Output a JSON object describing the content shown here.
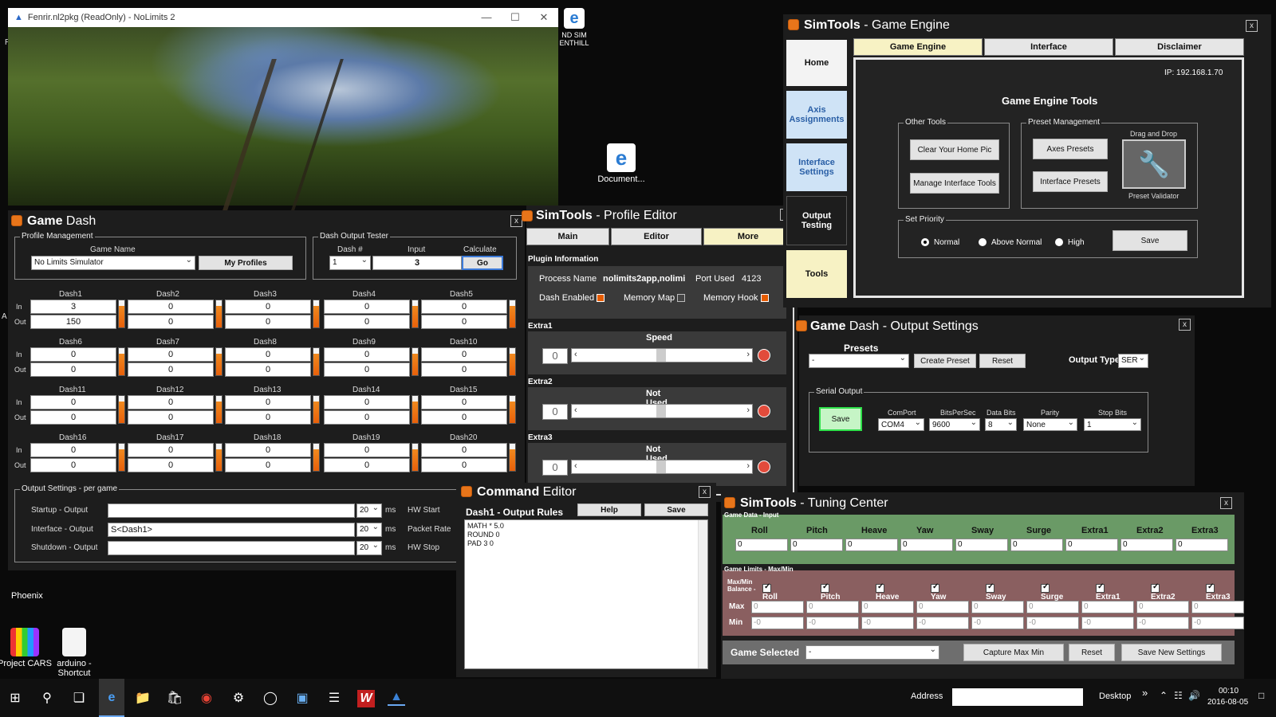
{
  "desktop": {
    "icons": [
      {
        "label": "Document...",
        "color": "#2b7cd3"
      },
      {
        "label": "Phoenix",
        "color": "#333"
      },
      {
        "label": "Project CARS",
        "color": "#1a7ad4"
      },
      {
        "label": "arduino - Shortcut",
        "color": "#f2f2f2"
      }
    ],
    "edge_shortcut_lines": [
      "ND SIM",
      "ENTHILL"
    ],
    "left_fragments": [
      "R",
      "A"
    ]
  },
  "nolimits": {
    "title": "Fenrir.nl2pkg (ReadOnly) - NoLimits 2",
    "controls": [
      "—",
      "☐",
      "✕"
    ]
  },
  "game_dash": {
    "title_bold": "Game",
    "title_rest": " Dash",
    "profile_mgmt": {
      "label": "Profile Management",
      "game_name_label": "Game Name",
      "game_name_value": "No Limits Simulator",
      "my_profiles": "My Profiles"
    },
    "tester": {
      "label": "Dash Output Tester",
      "dash_num_label": "Dash #",
      "dash_num_value": "1",
      "input_label": "Input",
      "input_value": "3",
      "calculate_label": "Calculate",
      "go": "Go"
    },
    "in_label": "In",
    "out_label": "Out",
    "dashes": [
      {
        "name": "Dash1",
        "in": "3",
        "out": "150"
      },
      {
        "name": "Dash2",
        "in": "0",
        "out": "0"
      },
      {
        "name": "Dash3",
        "in": "0",
        "out": "0"
      },
      {
        "name": "Dash4",
        "in": "0",
        "out": "0"
      },
      {
        "name": "Dash5",
        "in": "0",
        "out": "0"
      },
      {
        "name": "Dash6",
        "in": "0",
        "out": "0"
      },
      {
        "name": "Dash7",
        "in": "0",
        "out": "0"
      },
      {
        "name": "Dash8",
        "in": "0",
        "out": "0"
      },
      {
        "name": "Dash9",
        "in": "0",
        "out": "0"
      },
      {
        "name": "Dash10",
        "in": "0",
        "out": "0"
      },
      {
        "name": "Dash11",
        "in": "0",
        "out": "0"
      },
      {
        "name": "Dash12",
        "in": "0",
        "out": "0"
      },
      {
        "name": "Dash13",
        "in": "0",
        "out": "0"
      },
      {
        "name": "Dash14",
        "in": "0",
        "out": "0"
      },
      {
        "name": "Dash15",
        "in": "0",
        "out": "0"
      },
      {
        "name": "Dash16",
        "in": "0",
        "out": "0"
      },
      {
        "name": "Dash17",
        "in": "0",
        "out": "0"
      },
      {
        "name": "Dash18",
        "in": "0",
        "out": "0"
      },
      {
        "name": "Dash19",
        "in": "0",
        "out": "0"
      },
      {
        "name": "Dash20",
        "in": "0",
        "out": "0"
      }
    ],
    "output_settings": {
      "label": "Output Settings - per game",
      "ms": "ms",
      "rows": [
        {
          "label": "Startup - Output",
          "value": "",
          "rate": "20",
          "right": "HW Start"
        },
        {
          "label": "Interface - Output",
          "value": "S<Dash1>",
          "rate": "20",
          "right": "Packet Rate"
        },
        {
          "label": "Shutdown - Output",
          "value": "",
          "rate": "20",
          "right": "HW Stop"
        }
      ]
    }
  },
  "profile_editor": {
    "title_bold": "SimTools",
    "title_rest": " - Profile Editor",
    "tabs": [
      "Main",
      "Editor",
      "More"
    ],
    "plugin_info_label": "Plugin Information",
    "process_name_label": "Process Name",
    "process_name_value": "nolimits2app,nolimi",
    "port_used_label": "Port Used",
    "port_used_value": "4123",
    "dash_enabled": "Dash Enabled",
    "memory_map": "Memory Map",
    "memory_hook": "Memory Hook",
    "extras": [
      {
        "label": "Extra1",
        "title": "Speed",
        "value": "0"
      },
      {
        "label": "Extra2",
        "title": "Not Used",
        "value": "0"
      },
      {
        "label": "Extra3",
        "title": "Not Used",
        "value": "0"
      }
    ]
  },
  "command_editor": {
    "title_bold": "Command",
    "title_rest": " Editor",
    "rules_label": "Dash1 - Output Rules",
    "help": "Help",
    "save": "Save",
    "lines": [
      "MATH * 5.0",
      "ROUND 0",
      "PAD 3 0"
    ]
  },
  "game_engine": {
    "title_bold": "SimTools",
    "title_rest": " - Game Engine",
    "side": [
      "Home",
      "Axis Assignments",
      "Interface Settings",
      "Output Testing",
      "Tools"
    ],
    "tabs": [
      "Game Engine",
      "Interface",
      "Disclaimer"
    ],
    "ip": "IP: 192.168.1.70",
    "tools_title": "Game Engine Tools",
    "other_tools": {
      "label": "Other Tools",
      "buttons": [
        "Clear Your Home Pic",
        "Manage Interface Tools"
      ]
    },
    "preset_mgmt": {
      "label": "Preset Management",
      "buttons": [
        "Axes Presets",
        "Interface Presets"
      ],
      "drag_drop": "Drag and Drop",
      "validator": "Preset Validator"
    },
    "priority": {
      "label": "Set Priority",
      "options": [
        "Normal",
        "Above Normal",
        "High"
      ],
      "selected": "Normal",
      "save": "Save"
    }
  },
  "output_settings": {
    "title_bold": "Game",
    "title_rest": " Dash - Output Settings",
    "presets_label": "Presets",
    "preset_value": "-",
    "create": "Create Preset",
    "reset": "Reset",
    "output_type_label": "Output Type",
    "output_type_value": "SER",
    "serial_label": "Serial Output",
    "save": "Save",
    "fields": [
      {
        "label": "ComPort",
        "value": "COM4"
      },
      {
        "label": "BitsPerSec",
        "value": "9600"
      },
      {
        "label": "Data Bits",
        "value": "8"
      },
      {
        "label": "Parity",
        "value": "None"
      },
      {
        "label": "Stop Bits",
        "value": "1"
      }
    ]
  },
  "tuning": {
    "title_bold": "SimTools",
    "title_rest": " - Tuning Center",
    "game_data_label": "Game Data - Input",
    "axes": [
      "Roll",
      "Pitch",
      "Heave",
      "Yaw",
      "Sway",
      "Surge",
      "Extra1",
      "Extra2",
      "Extra3"
    ],
    "inputs": [
      "0",
      "0",
      "0",
      "0",
      "0",
      "0",
      "0",
      "0",
      "0"
    ],
    "limits_label": "Game Limits - Max/Min",
    "maxmin_label": "Max/Min",
    "balance_label": "Balance -",
    "max_label": "Max",
    "min_label": "Min",
    "max_values": [
      "0",
      "0",
      "0",
      "0",
      "0",
      "0",
      "0",
      "0",
      "0"
    ],
    "min_values": [
      "-0",
      "-0",
      "-0",
      "-0",
      "-0",
      "-0",
      "-0",
      "-0",
      "-0"
    ],
    "game_selected_label": "Game Selected",
    "game_selected_value": "-",
    "capture": "Capture Max Min",
    "reset": "Reset",
    "save_new": "Save New Settings"
  },
  "taskbar": {
    "address_label": "Address",
    "desktop_label": "Desktop",
    "time": "00:10",
    "date": "2016-08-05"
  }
}
